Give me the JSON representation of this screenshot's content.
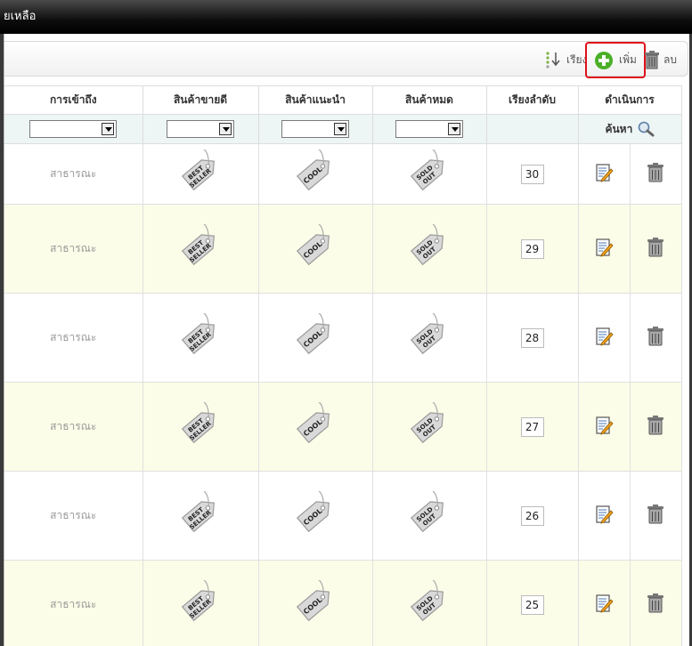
{
  "window": {
    "title": "ยเหลือ"
  },
  "toolbar": {
    "sort_label": "เรียง",
    "add_label": "เพิ่ม",
    "delete_label": "ลบ"
  },
  "columns": [
    "การเข้าถึง",
    "สินค้าขายดี",
    "สินค้าแนะนำ",
    "สินค้าหมด",
    "เรียงลำดับ",
    "ดำเนินการ"
  ],
  "filter": {
    "access_value": "",
    "best_value": "",
    "cool_value": "",
    "soldout_value": "",
    "search_label": "ค้นหา"
  },
  "tags": {
    "best": [
      "BEST",
      "SELLER"
    ],
    "cool": "COOL",
    "soldout": [
      "SOLD",
      "OUT"
    ]
  },
  "rows": [
    {
      "access": "สาธารณะ",
      "order": "30"
    },
    {
      "access": "สาธารณะ",
      "order": "29"
    },
    {
      "access": "สาธารณะ",
      "order": "28"
    },
    {
      "access": "สาธารณะ",
      "order": "27"
    },
    {
      "access": "สาธารณะ",
      "order": "26"
    },
    {
      "access": "สาธารณะ",
      "order": "25"
    }
  ],
  "colors": {
    "add_highlight": "#e0101a",
    "alt_row": "#fcfde8",
    "filter_row": "#eef5f5",
    "add_icon": "#4caf28"
  }
}
